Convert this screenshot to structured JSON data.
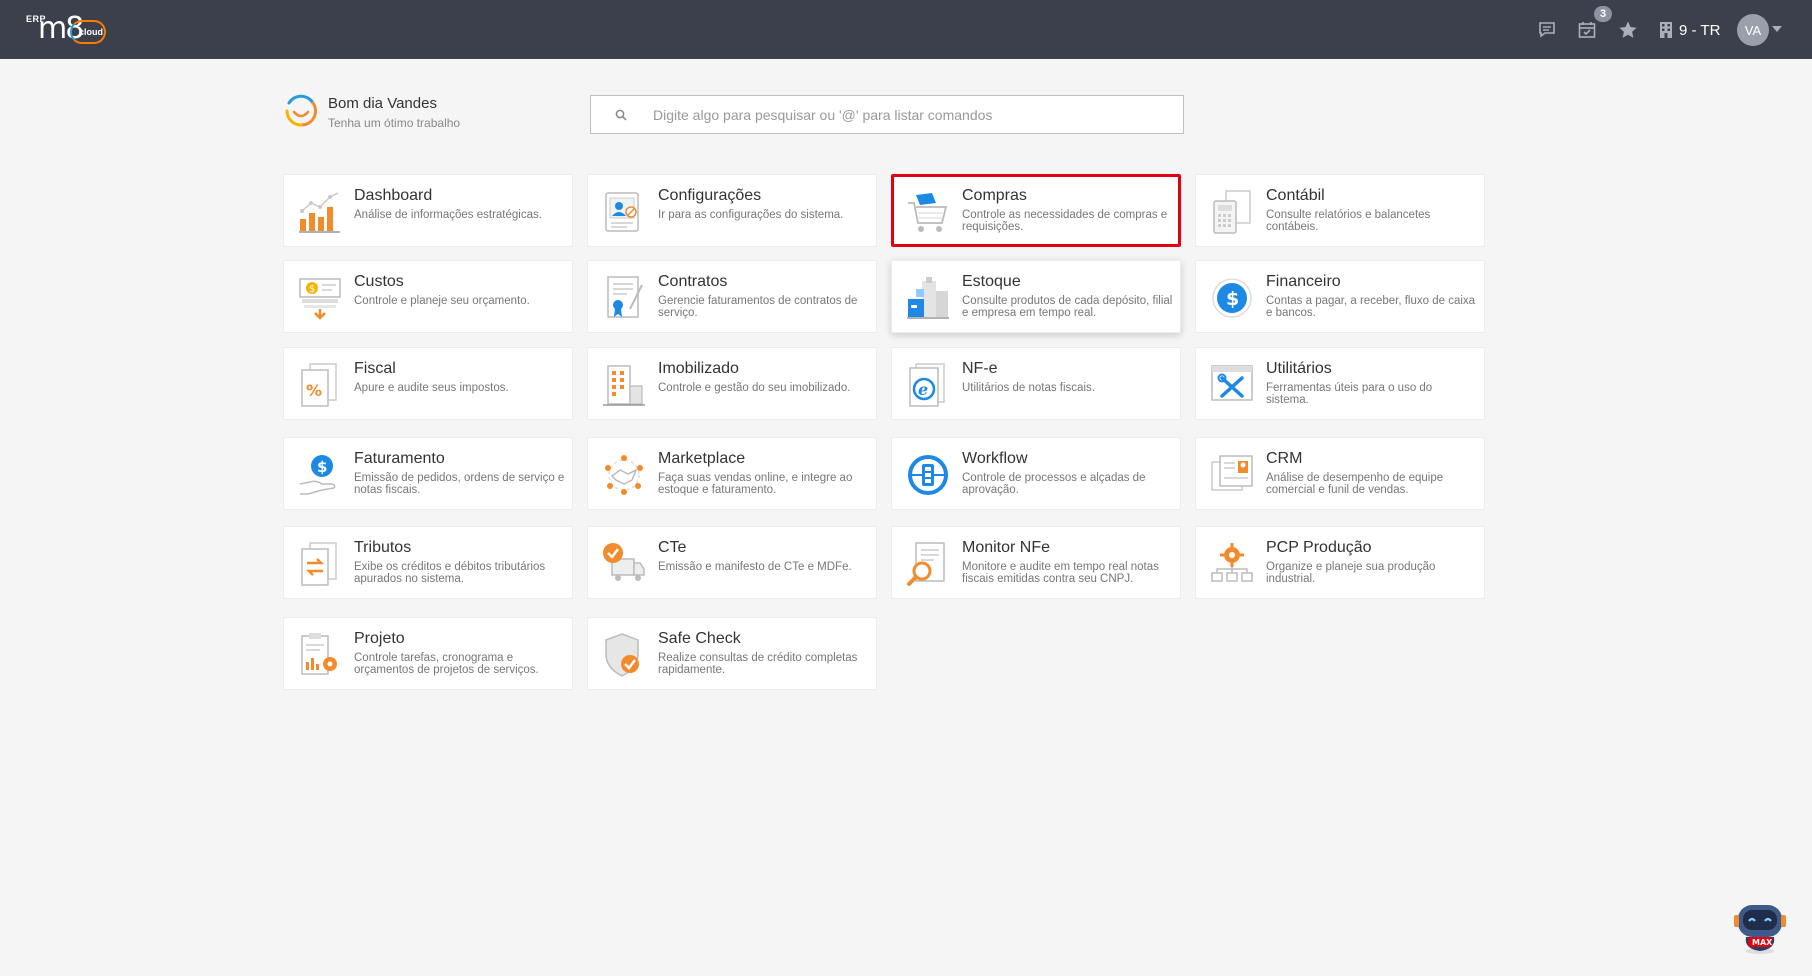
{
  "topbar": {
    "logo_erp": "ERP",
    "logo_m8": "m8",
    "logo_cloud": "cloud",
    "notifications_count": "3",
    "company": "9 - TR",
    "avatar_initials": "VA"
  },
  "greeting": {
    "title": "Bom dia Vandes",
    "subtitle": "Tenha um ótimo trabalho"
  },
  "search": {
    "placeholder": "Digite algo para pesquisar ou '@' para listar comandos"
  },
  "modules": [
    {
      "title": "Dashboard",
      "desc": "Análise de informações estratégicas."
    },
    {
      "title": "Configurações",
      "desc": "Ir para as configurações do sistema."
    },
    {
      "title": "Compras",
      "desc": "Controle as necessidades de compras e requisições."
    },
    {
      "title": "Contábil",
      "desc": "Consulte relatórios e balancetes contábeis."
    },
    {
      "title": "Custos",
      "desc": "Controle e planeje seu orçamento."
    },
    {
      "title": "Contratos",
      "desc": "Gerencie faturamentos de contratos de serviço."
    },
    {
      "title": "Estoque",
      "desc": "Consulte produtos de cada depósito, filial e empresa em tempo real."
    },
    {
      "title": "Financeiro",
      "desc": "Contas a pagar, a receber, fluxo de caixa e bancos."
    },
    {
      "title": "Fiscal",
      "desc": "Apure e audite seus impostos."
    },
    {
      "title": "Imobilizado",
      "desc": "Controle e gestão do seu imobilizado."
    },
    {
      "title": "NF-e",
      "desc": "Utilitários de notas fiscais."
    },
    {
      "title": "Utilitários",
      "desc": "Ferramentas úteis para o uso do sistema."
    },
    {
      "title": "Faturamento",
      "desc": "Emissão de pedidos, ordens de serviço e notas fiscais."
    },
    {
      "title": "Marketplace",
      "desc": "Faça suas vendas online, e integre ao estoque e faturamento."
    },
    {
      "title": "Workflow",
      "desc": "Controle de processos e alçadas de aprovação."
    },
    {
      "title": "CRM",
      "desc": "Análise de desempenho de equipe comercial e funil de vendas."
    },
    {
      "title": "Tributos",
      "desc": "Exibe os créditos e débitos tributários apurados no sistema."
    },
    {
      "title": "CTe",
      "desc": "Emissão e manifesto de CTe e MDFe."
    },
    {
      "title": "Monitor NFe",
      "desc": "Monitore e audite em tempo real notas fiscais emitidas contra seu CNPJ."
    },
    {
      "title": "PCP Produção",
      "desc": "Organize e planeje sua produção industrial."
    },
    {
      "title": "Projeto",
      "desc": "Controle tarefas, cronograma e orçamentos de projetos de serviços."
    },
    {
      "title": "Safe Check",
      "desc": "Realize consultas de crédito completas rapidamente."
    }
  ],
  "bot": {
    "label": "MAX"
  },
  "colors": {
    "topbar": "#3b404c",
    "orange": "#f28b2b",
    "blue": "#1e88e5",
    "highlight": "#e3000f"
  }
}
